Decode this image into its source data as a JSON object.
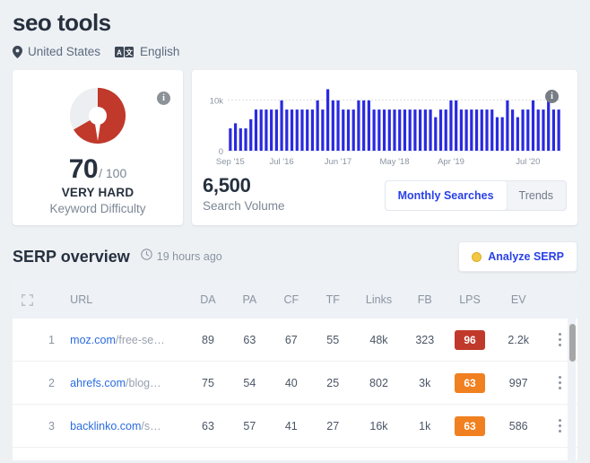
{
  "header": {
    "keyword": "seo tools",
    "country": "United States",
    "language": "English",
    "pin_icon": "location-pin-icon",
    "lang_icon": "translate-icon"
  },
  "keyword_difficulty": {
    "score": "70",
    "out_of": "/ 100",
    "rating": "VERY HARD",
    "caption": "Keyword Difficulty",
    "info_icon": "info-icon",
    "percent": 70,
    "arc_color": "#c0392b",
    "track_color": "#eceef1"
  },
  "search_volume": {
    "value": "6,500",
    "caption": "Search Volume",
    "info_icon": "info-icon",
    "tabs": [
      {
        "label": "Monthly Searches",
        "active": true
      },
      {
        "label": "Trends",
        "active": false
      }
    ]
  },
  "chart_data": {
    "type": "bar",
    "title": "Search Volume",
    "xlabel": "",
    "ylabel": "",
    "ylim": [
      0,
      12000
    ],
    "grid": true,
    "legend": null,
    "ytick_labels": [
      "0",
      "10k"
    ],
    "ytick_values": [
      0,
      10000
    ],
    "xtick_labels": [
      "Sep '15",
      "Jul '16",
      "Jun '17",
      "May '18",
      "Apr '19",
      "Jul '20"
    ],
    "xtick_indices": [
      0,
      10,
      21,
      32,
      43,
      58
    ],
    "bar_color": "#2a2ae0",
    "annotation": {
      "label": "info-icon",
      "bar_index": 62
    },
    "values": [
      4400,
      5400,
      4400,
      4400,
      6200,
      8100,
      8100,
      8100,
      8100,
      8100,
      9900,
      8100,
      8100,
      8100,
      8100,
      8100,
      8100,
      9900,
      8100,
      12100,
      9900,
      9900,
      8100,
      8100,
      8100,
      9900,
      9900,
      9900,
      8100,
      8100,
      8100,
      8100,
      8100,
      8100,
      8100,
      8100,
      8100,
      8100,
      8100,
      8100,
      6600,
      8100,
      8100,
      9900,
      9900,
      8100,
      8100,
      8100,
      8100,
      8100,
      8100,
      8100,
      6600,
      6600,
      9900,
      8100,
      6600,
      8100,
      8100,
      9900,
      8100,
      8100,
      9900,
      8100,
      8100
    ]
  },
  "serp_overview": {
    "title": "SERP overview",
    "updated": "19 hours ago",
    "clock_icon": "clock-icon",
    "analyze_button": {
      "label": "Analyze SERP",
      "coin_icon": "coin-icon"
    }
  },
  "table": {
    "expand_icon": "expand-icon",
    "kebab_icon": "kebab-menu-icon",
    "columns": [
      "URL",
      "DA",
      "PA",
      "CF",
      "TF",
      "Links",
      "FB",
      "LPS",
      "EV"
    ],
    "rows": [
      {
        "rank": "1",
        "domain": "moz.com",
        "path": "/free-se…",
        "da": "89",
        "pa": "63",
        "cf": "67",
        "tf": "55",
        "links": "48k",
        "fb": "323",
        "lps": "96",
        "lps_color": "#c0392b",
        "ev": "2.2k"
      },
      {
        "rank": "2",
        "domain": "ahrefs.com",
        "path": "/blog…",
        "da": "75",
        "pa": "54",
        "cf": "40",
        "tf": "25",
        "links": "802",
        "fb": "3k",
        "lps": "63",
        "lps_color": "#f08020",
        "ev": "997"
      },
      {
        "rank": "3",
        "domain": "backlinko.com",
        "path": "/s…",
        "da": "63",
        "pa": "57",
        "cf": "41",
        "tf": "27",
        "links": "16k",
        "fb": "1k",
        "lps": "63",
        "lps_color": "#f08020",
        "ev": "586"
      }
    ]
  }
}
